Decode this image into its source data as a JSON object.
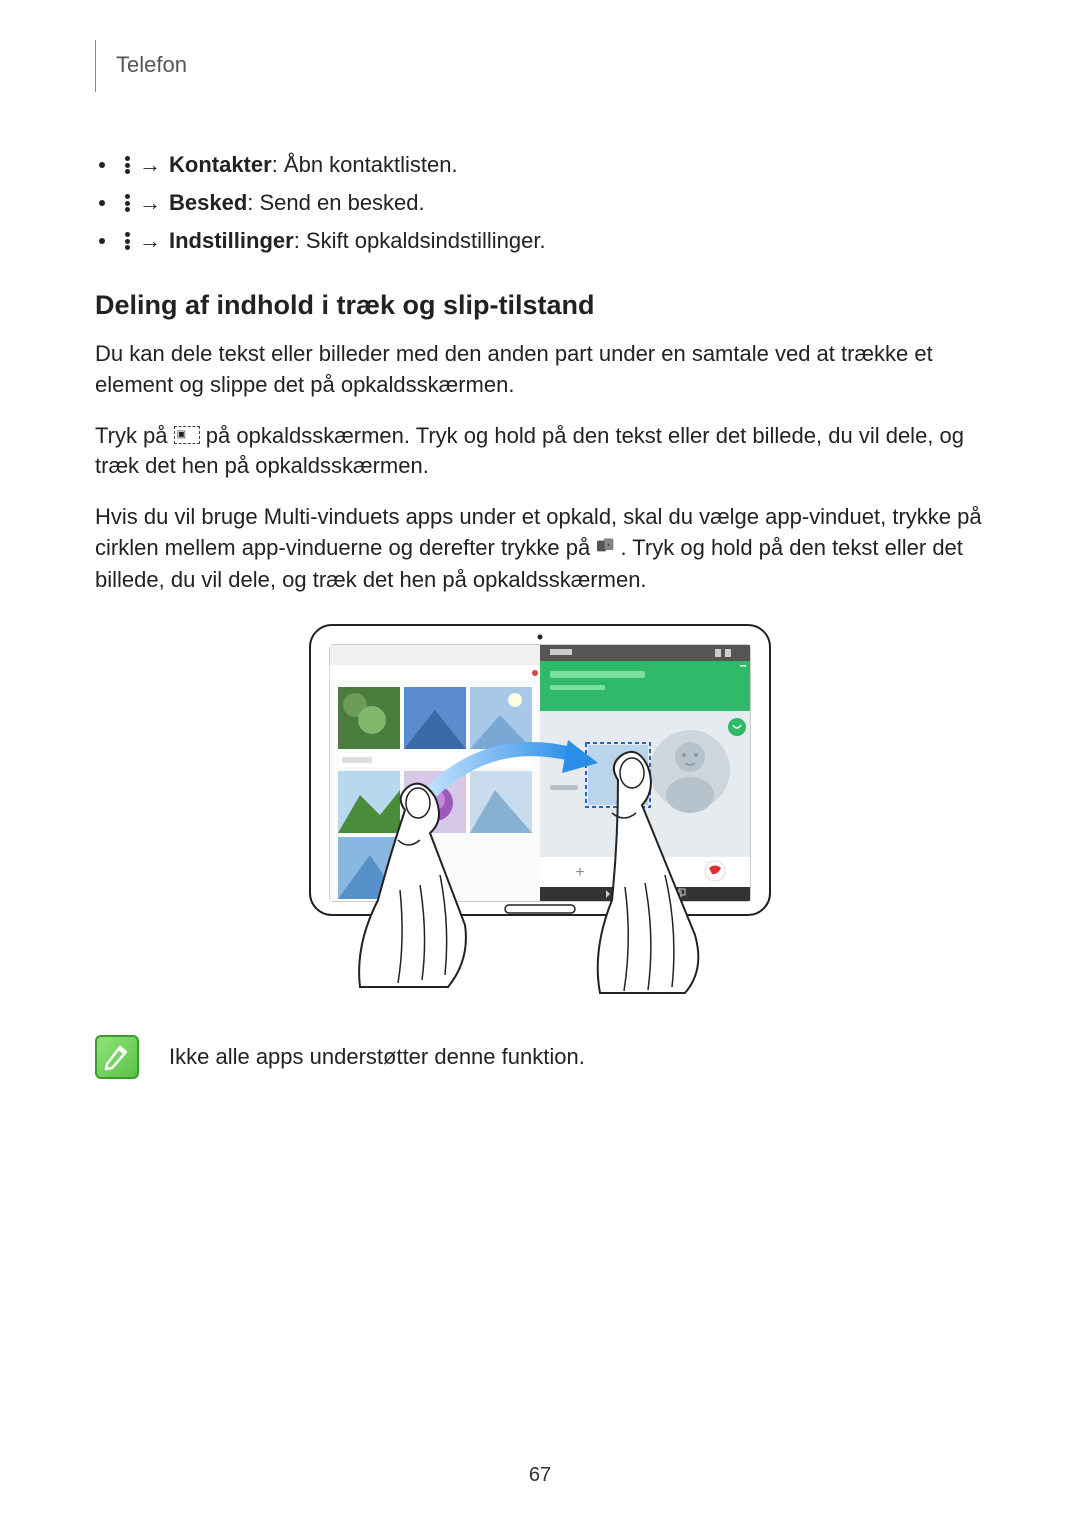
{
  "header": {
    "title": "Telefon"
  },
  "bullets": [
    {
      "label": "Kontakter",
      "desc": ": Åbn kontaktlisten."
    },
    {
      "label": "Besked",
      "desc": ": Send en besked."
    },
    {
      "label": "Indstillinger",
      "desc": ": Skift opkaldsindstillinger."
    }
  ],
  "heading": "Deling af indhold i træk og slip-tilstand",
  "paragraphs": {
    "p1": "Du kan dele tekst eller billeder med den anden part under en samtale ved at trække et element og slippe det på opkaldsskærmen.",
    "p2_a": "Tryk på ",
    "p2_b": " på opkaldsskærmen. Tryk og hold på den tekst eller det billede, du vil dele, og træk det hen på opkaldsskærmen.",
    "p3_a": "Hvis du vil bruge Multi-vinduets apps under et opkald, skal du vælge app-vinduet, trykke på cirklen mellem app-vinduerne og derefter trykke på ",
    "p3_b": ". Tryk og hold på den tekst eller det billede, du vil dele, og træk det hen på opkaldsskærmen."
  },
  "note": "Ikke alle apps understøtter denne funktion.",
  "page_number": "67"
}
